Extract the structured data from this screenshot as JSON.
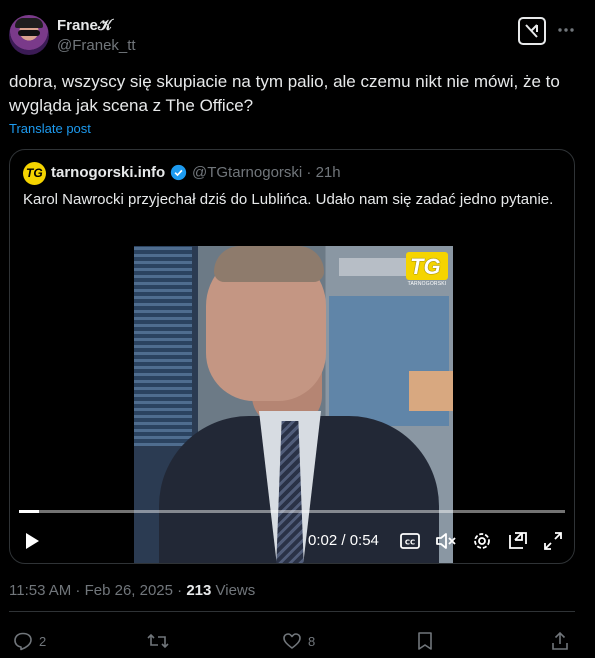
{
  "post": {
    "author_name": "Frane𝒦",
    "author_handle": "@Franek_tt",
    "text": "dobra, wszyscy się skupiacie na tym palio, ale czemu nikt nie mówi, że to wygląda jak scena z The Office?",
    "translate_label": "Translate post",
    "timestamp": "11:53 AM · Feb 26, 2025 · ",
    "views_count": "213",
    "views_label": " Views"
  },
  "quote": {
    "author_name": "tarnogorski.info",
    "logo_text": "TG",
    "author_handle": "@TGtarnogorski · 21h",
    "text": "Karol Nawrocki przyjechał dziś do Lublińca. Udało nam się zadać jedno pytanie.",
    "video": {
      "watermark": "TG",
      "watermark_sub": "TARNOGORSKI",
      "time": "0:02 / 0:54",
      "progress": 0.037
    }
  },
  "actions": {
    "replies": "2",
    "reposts": "",
    "likes": "8"
  },
  "icons": [
    "grok-icon",
    "more-icon",
    "verified-icon",
    "play-icon",
    "captions-icon",
    "mute-icon",
    "settings-icon",
    "pip-icon",
    "fullscreen-icon",
    "reply-icon",
    "repost-icon",
    "like-icon",
    "bookmark-icon",
    "share-icon"
  ],
  "colors": {
    "background": "#000000",
    "text": "#e7e9ea",
    "muted": "#71767b",
    "accent": "#1d9bf0",
    "border": "#2f3336",
    "brand_yellow": "#f5d400"
  }
}
